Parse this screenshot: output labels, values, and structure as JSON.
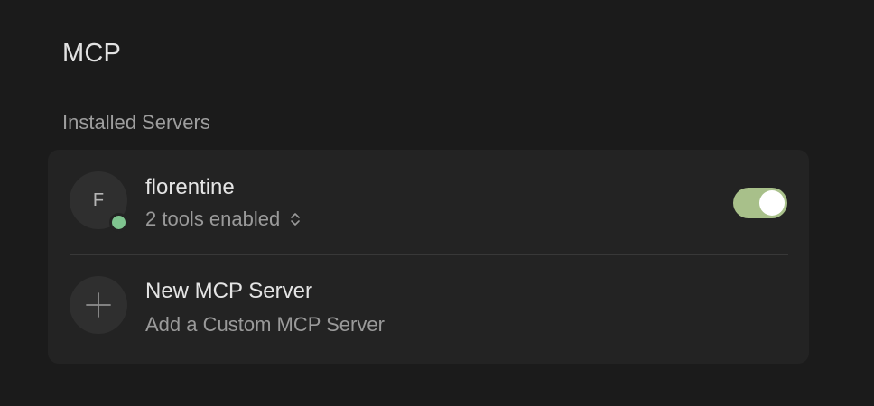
{
  "page": {
    "title": "MCP",
    "section_title": "Installed Servers"
  },
  "servers": [
    {
      "avatar_letter": "F",
      "name": "florentine",
      "tools_summary": "2 tools enabled",
      "status": "connected",
      "status_color": "#7fc48f",
      "enabled": true,
      "toggle_color": "#a8c08a"
    }
  ],
  "new_server": {
    "title": "New MCP Server",
    "subtitle": "Add a Custom MCP Server",
    "icon": "plus-icon"
  },
  "colors": {
    "background": "#1b1b1b",
    "card": "#232323",
    "avatar_bg": "#2f2f2f"
  }
}
